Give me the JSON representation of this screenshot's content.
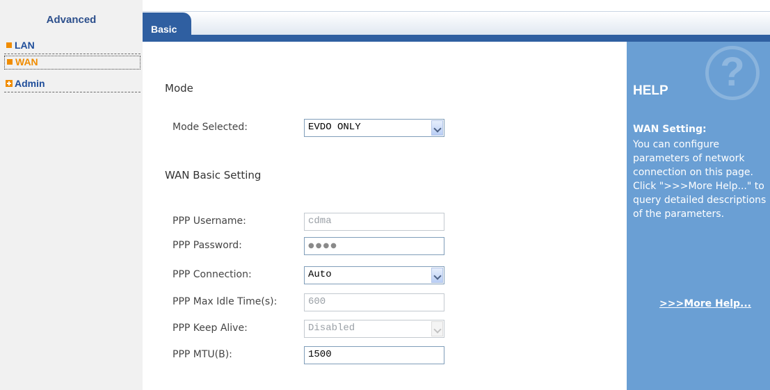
{
  "sidebar": {
    "title": "Advanced",
    "items": [
      {
        "label": "LAN"
      },
      {
        "label": "WAN"
      },
      {
        "label": "Admin"
      }
    ]
  },
  "tabs": [
    {
      "label": "Basic"
    }
  ],
  "form": {
    "mode_section": "Mode",
    "mode_selected_label": "Mode Selected:",
    "mode_selected_value": "EVDO ONLY",
    "wan_section": "WAN Basic Setting",
    "ppp_username_label": "PPP Username:",
    "ppp_username_value": "cdma",
    "ppp_password_label": "PPP Password:",
    "ppp_password_value": "●●●●",
    "ppp_connection_label": "PPP Connection:",
    "ppp_connection_value": "Auto",
    "ppp_idle_label": "PPP Max Idle Time(s):",
    "ppp_idle_value": "600",
    "ppp_keepalive_label": "PPP Keep Alive:",
    "ppp_keepalive_value": "Disabled",
    "ppp_mtu_label": "PPP MTU(B):",
    "ppp_mtu_value": "1500"
  },
  "help": {
    "title": "HELP",
    "icon_glyph": "?",
    "heading": "WAN Setting:",
    "text": "You can configure parameters of network connection on this page. Click \">>>More Help...\" to query detailed descriptions of the parameters.",
    "more_link": ">>>More Help..."
  },
  "colors": {
    "accent_blue": "#2f5fa1",
    "help_panel": "#6a9fd4",
    "sidebar_marker": "#f08c00"
  }
}
